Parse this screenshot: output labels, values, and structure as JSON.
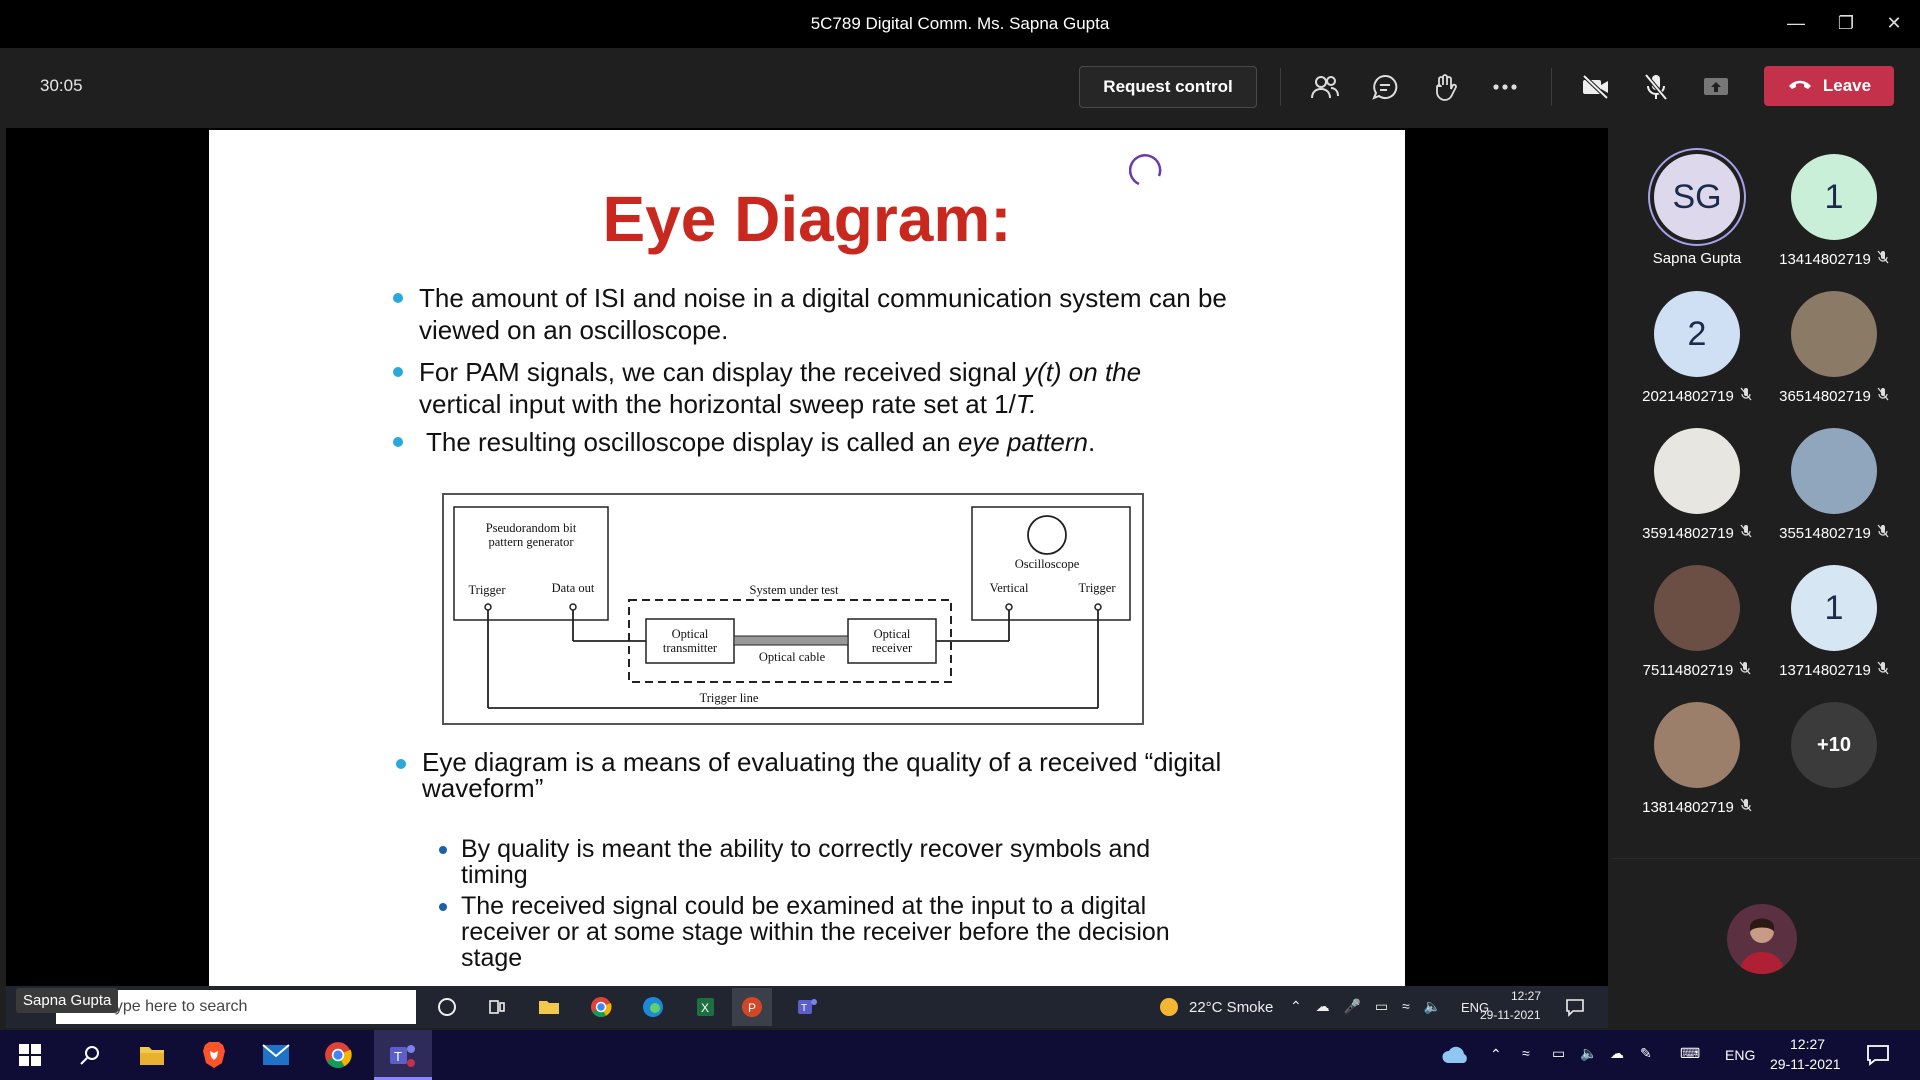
{
  "window": {
    "title": "5C789 Digital Comm. Ms. Sapna Gupta"
  },
  "toolbar": {
    "timer": "30:05",
    "request_control": "Request control",
    "leave": "Leave"
  },
  "slide": {
    "title": "Eye Diagram:",
    "bullet1": "The amount of ISI and noise in a digital communication system can be viewed on an oscilloscope.",
    "bullet2_a": "For PAM signals, we can display the received signal ",
    "bullet2_b": "y(t) on the",
    "bullet2_c": "vertical input with the horizontal sweep rate set at 1/",
    "bullet2_d": "T.",
    "bullet3_a": "The resulting oscilloscope display is called an ",
    "bullet3_b": "eye pattern",
    "bullet3_c": ".",
    "bullet4": "Eye diagram is a means of evaluating the quality of a received “digital waveform”",
    "sub1": "By quality is meant the ability to correctly recover symbols and timing",
    "sub2": "The received signal could be examined at the input to a digital receiver or at some stage within the receiver before the decision stage",
    "diagram": {
      "generator": "Pseudorandom bit pattern generator",
      "trigger_out": "Trigger",
      "data_out": "Data out",
      "system_under_test": "System under test",
      "optical_tx": "Optical transmitter",
      "optical_cable": "Optical cable",
      "optical_rx": "Optical receiver",
      "oscilloscope": "Oscilloscope",
      "vertical": "Vertical",
      "trigger_in": "Trigger",
      "trigger_line": "Trigger line"
    }
  },
  "participants": [
    {
      "initials": "SG",
      "name": "Sapna Gupta",
      "color": "#ddd8ec",
      "muted": false
    },
    {
      "initials": "1",
      "name": "13414802719",
      "color": "#c9efd9",
      "muted": true
    },
    {
      "initials": "2",
      "name": "20214802719",
      "color": "#cfe0f4",
      "muted": true
    },
    {
      "initials": "",
      "name": "36514802719",
      "color": "#8a7a66",
      "muted": true
    },
    {
      "initials": "",
      "name": "35914802719",
      "color": "#e8e6e0",
      "muted": true
    },
    {
      "initials": "",
      "name": "35514802719",
      "color": "#8fa6bd",
      "muted": true
    },
    {
      "initials": "",
      "name": "75114802719",
      "color": "#6b4e44",
      "muted": true
    },
    {
      "initials": "1",
      "name": "13714802719",
      "color": "#d7e6f3",
      "muted": true
    },
    {
      "initials": "",
      "name": "13814802719",
      "color": "#9c7f6a",
      "muted": true
    },
    {
      "initials": "+10",
      "name": "",
      "color": "#3b3b3b",
      "muted": false
    }
  ],
  "shared_taskbar": {
    "presenter": "Sapna Gupta",
    "search_placeholder": "Type here to search",
    "weather": "22°C  Smoke",
    "lang": "ENG",
    "time": "12:27",
    "date": "29-11-2021"
  },
  "taskbar": {
    "lang": "ENG",
    "time": "12:27",
    "date": "29-11-2021"
  },
  "colors": {
    "leave": "#c4314b",
    "slide_title": "#c8281e",
    "bullet": "#2aa8d8",
    "taskbar": "#0f0c36"
  }
}
